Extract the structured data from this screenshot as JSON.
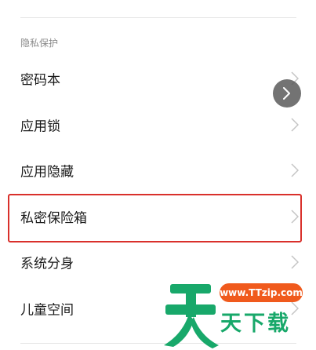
{
  "section": {
    "title": "隐私保护"
  },
  "items": [
    {
      "label": "密码本"
    },
    {
      "label": "应用锁"
    },
    {
      "label": "应用隐藏"
    },
    {
      "label": "私密保险箱"
    },
    {
      "label": "系统分身"
    },
    {
      "label": "儿童空间"
    }
  ],
  "watermark": {
    "url": "www.TTzip.com",
    "name": "天下载"
  },
  "colors": {
    "highlight": "#d9302b",
    "watermark_green": "#18a86a",
    "watermark_orange": "#f05a1d"
  },
  "icons": {
    "chevron": "chevron-right-icon",
    "float": "chevron-right-icon"
  }
}
